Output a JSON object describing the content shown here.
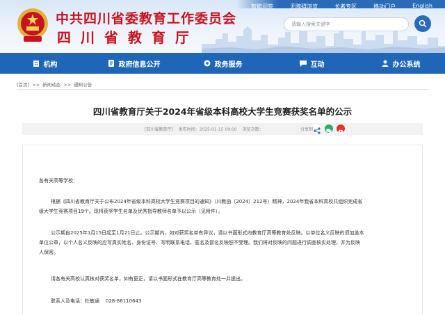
{
  "header": {
    "org_title": "中共四川省委教育工作委员会",
    "org_subtitle": "四川省教育厅",
    "top_links": [
      "智能问答",
      "无障碍浏览",
      "长者专区",
      "移动门户",
      "English"
    ],
    "search_placeholder": "请输入搜索关键字"
  },
  "nav": {
    "items": [
      {
        "label": "机构",
        "icon": "building-icon"
      },
      {
        "label": "政府信息公开",
        "icon": "document-icon"
      },
      {
        "label": "政务服务",
        "icon": "gear-icon"
      },
      {
        "label": "互动",
        "icon": "chat-icon"
      },
      {
        "label": "办公系统",
        "icon": "user-icon"
      }
    ]
  },
  "breadcrumb": [
    "[首页]",
    ">>",
    "新闻动态",
    ">>",
    "通知公告"
  ],
  "article": {
    "title": "四川省教育厅关于2024年省级本科高校大学生竞赛获奖名单的公示",
    "source": "[四川省教育厅]",
    "published": "发布时间：2025-01-15 09:00",
    "views": "浏览次数：",
    "share_label": "分享到：",
    "greeting": "各有关高等学校：",
    "para1_line1": "根据《四川省教育厅关于公布2024年省级本科高校大学生竞赛项目的通知》（川教函〔2024〕212号）精神，2024年我省本科高校共组织完成省",
    "para1_line2": "级大学生竞赛项目19个。现将获奖学生名单及优秀指导教师名单予以公示（见附件）。",
    "para2_line1": "公示期自2025年1月15日起至1月21日止。公示期内，如对获奖名单有异议，请以书面形式向教育厅高等教育处反映。以单位名义反映的须加盖本",
    "para2_line2": "单位公章，以个人名义反映的应写真实姓名、身份证号、写明联系电话，匿名及冒名反映恕不受理。我们将对反映的问题进行调查核实处理，并为反映",
    "para2_line3": "人保密。",
    "para3": "请各有关高校认真核对获奖名单，如有更正，请以书面形式在教育厅高等教育处一并提出。",
    "contact": "联系人及电话：杜敏通    028-86110643"
  }
}
